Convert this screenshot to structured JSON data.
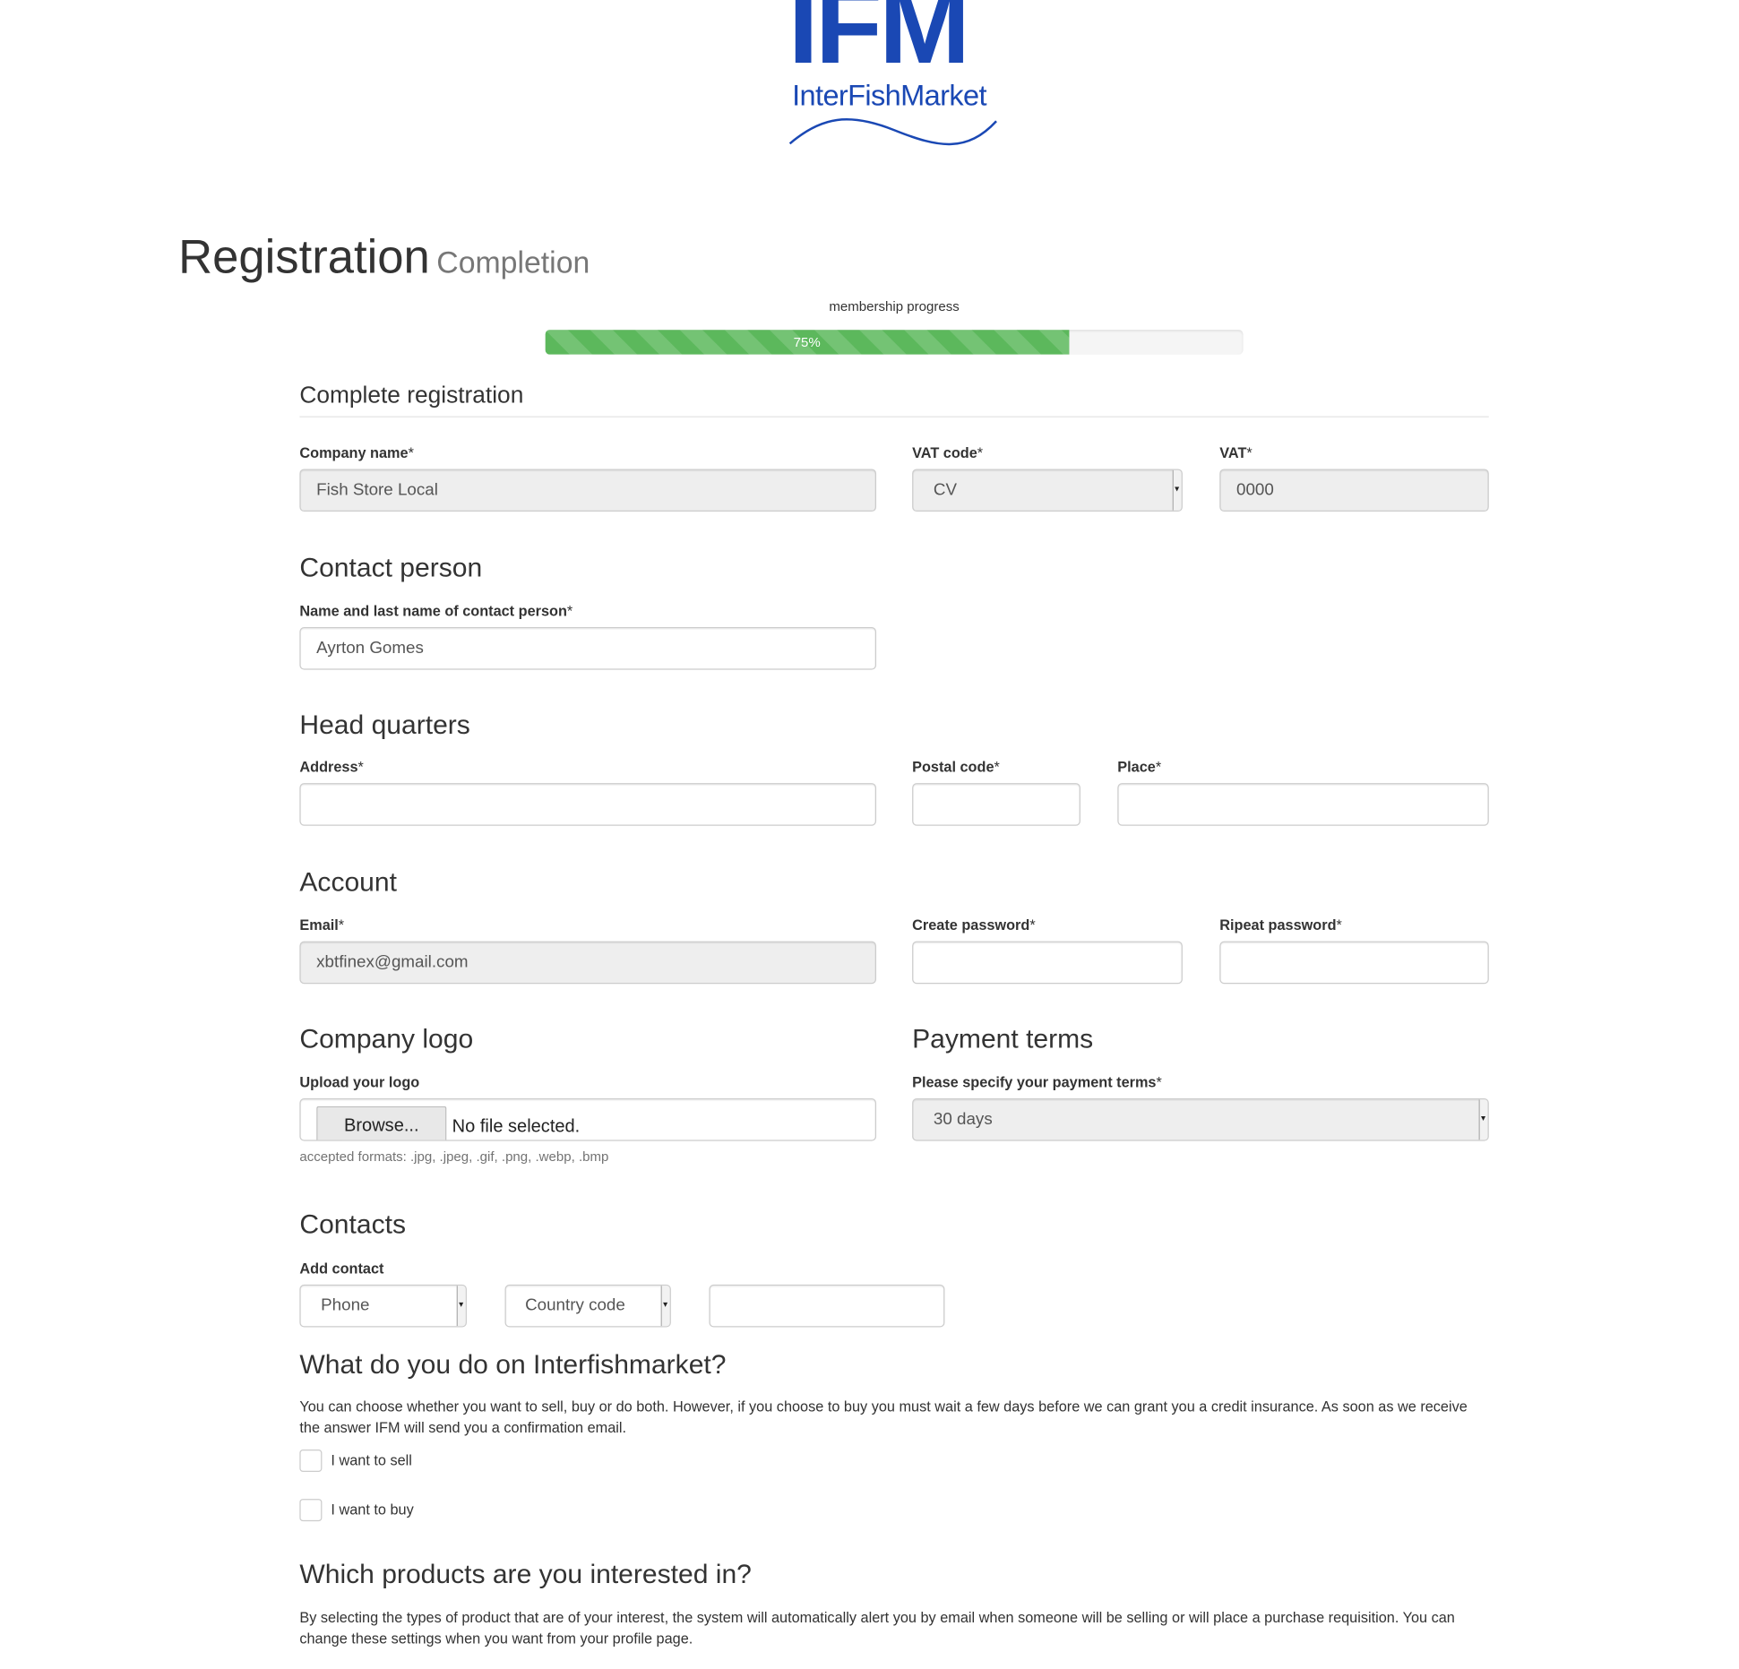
{
  "logo": {
    "mark": "IFM",
    "name": "InterFishMarket",
    "color": "#1a48b4"
  },
  "header": {
    "title": "Registration",
    "subtitle": "Completion"
  },
  "progress": {
    "label": "membership progress",
    "value_percent": 75,
    "text": "75%",
    "color": "#5cb85c"
  },
  "complete_registration": {
    "legend": "Complete registration",
    "company_name_label": "Company name",
    "company_name_value": "Fish Store Local",
    "vat_code_label": "VAT code",
    "vat_code_value": "CV",
    "vat_label": "VAT",
    "vat_value": "0000",
    "required_mark": "*"
  },
  "contact_person": {
    "heading": "Contact person",
    "name_label": "Name and last name of contact person",
    "name_value": "Ayrton Gomes"
  },
  "head_quarters": {
    "heading": "Head quarters",
    "address_label": "Address",
    "address_value": "",
    "postal_code_label": "Postal code",
    "postal_code_value": "",
    "place_label": "Place",
    "place_value": ""
  },
  "account": {
    "heading": "Account",
    "email_label": "Email",
    "email_value": "xbtfinex@gmail.com",
    "password_label": "Create password",
    "repeat_password_label": "Ripeat password"
  },
  "company_logo": {
    "heading": "Company logo",
    "upload_label": "Upload your logo",
    "browse_button": "Browse...",
    "file_status": "No file selected.",
    "help": "accepted formats: .jpg, .jpeg, .gif, .png, .webp, .bmp"
  },
  "payment_terms": {
    "heading": "Payment terms",
    "label": "Please specify your payment terms",
    "selected": "30 days"
  },
  "contacts": {
    "heading": "Contacts",
    "add_label": "Add contact",
    "type_selected": "Phone",
    "country_code_selected": "Country code",
    "number_value": ""
  },
  "activity": {
    "heading": "What do you do on Interfishmarket?",
    "description": "You can choose whether you want to sell, buy or do both. However, if you choose to buy you must wait a few days before we can grant you a credit insurance. As soon as we receive the answer IFM will send you a confirmation email.",
    "sell_label": "I want to sell",
    "buy_label": "I want to buy"
  },
  "products": {
    "heading": "Which products are you interested in?",
    "description": "By selecting the types of product that are of your interest, the system will automatically alert you by email when someone will be selling or will place a purchase requisition. You can change these settings when you want from your profile page."
  }
}
